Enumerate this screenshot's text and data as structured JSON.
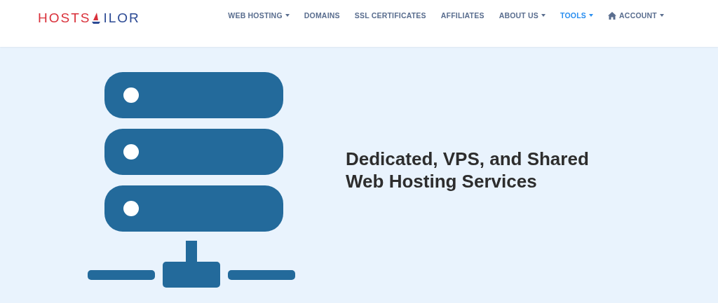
{
  "logo": {
    "left": "HOSTS",
    "right": "ILOR"
  },
  "nav": [
    {
      "kind": "link",
      "label": "WEB HOSTING",
      "dropdown": true,
      "selected": false
    },
    {
      "kind": "link",
      "label": "DOMAINS",
      "dropdown": false,
      "selected": false
    },
    {
      "kind": "link",
      "label": "SSL CERTIFICATES",
      "dropdown": false,
      "selected": false
    },
    {
      "kind": "link",
      "label": "AFFILIATES",
      "dropdown": false,
      "selected": false
    },
    {
      "kind": "link",
      "label": "ABOUT US",
      "dropdown": true,
      "selected": false
    },
    {
      "kind": "link",
      "label": "TOOLS",
      "dropdown": true,
      "selected": true
    },
    {
      "kind": "account",
      "label": "ACCOUNT",
      "dropdown": true,
      "selected": false
    }
  ],
  "hero": {
    "heading": "Dedicated, VPS, and Shared Web Hosting Services"
  }
}
